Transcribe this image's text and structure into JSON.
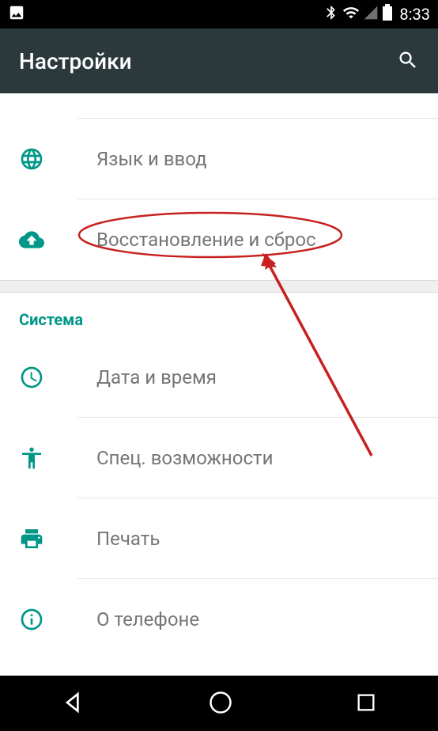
{
  "status": {
    "time": "8:33"
  },
  "appbar": {
    "title": "Настройки"
  },
  "items": {
    "language": "Язык и ввод",
    "backup": "Восстановление и сброс",
    "datetime": "Дата и время",
    "accessibility": "Спец. возможности",
    "print": "Печать",
    "about": "О телефоне"
  },
  "section": {
    "system": "Система"
  },
  "colors": {
    "accent": "#009688",
    "appbar": "#2b393d",
    "highlight": "#c6211e"
  }
}
